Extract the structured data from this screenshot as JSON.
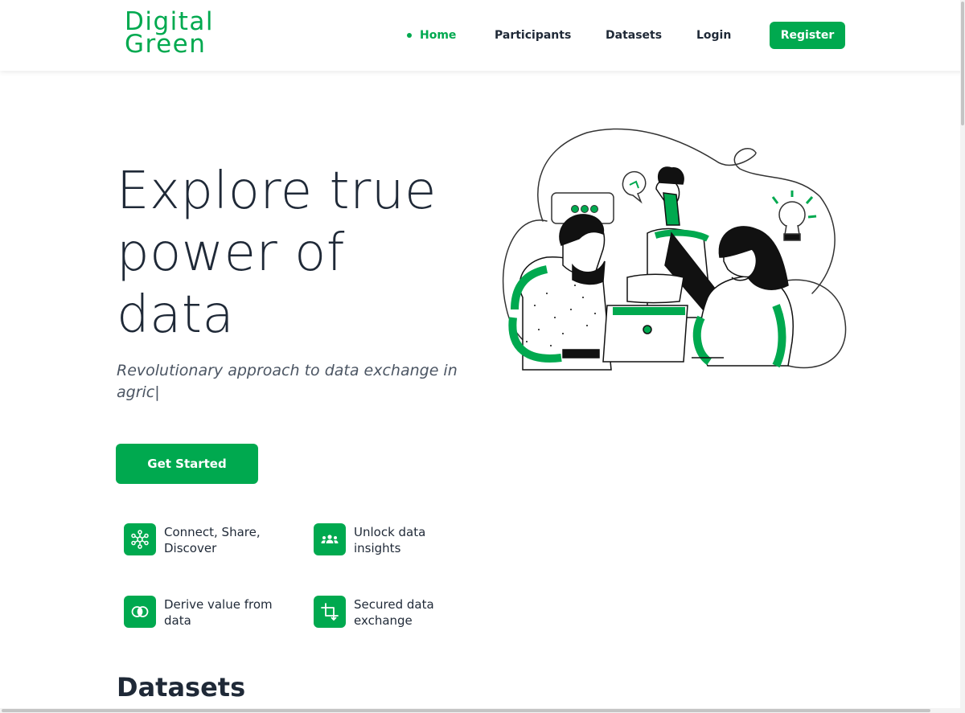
{
  "header": {
    "logo_line1": "Digital",
    "logo_line2": "Green",
    "nav": [
      {
        "label": "Home",
        "active": true
      },
      {
        "label": "Participants",
        "active": false
      },
      {
        "label": "Datasets",
        "active": false
      },
      {
        "label": "Login",
        "active": false
      }
    ],
    "register_label": "Register"
  },
  "hero": {
    "title": "Explore true power of data",
    "subtitle": "Revolutionary approach to data exchange in agric|",
    "cta_label": "Get Started",
    "illustration_icon": "team-collaboration-illustration"
  },
  "features": [
    {
      "label": "Connect, Share, Discover",
      "icon": "network-icon"
    },
    {
      "label": "Unlock data insights",
      "icon": "group-icon"
    },
    {
      "label": "Derive value from data",
      "icon": "overlapping-circles-icon"
    },
    {
      "label": "Secured data exchange",
      "icon": "crop-icon"
    }
  ],
  "datasets_section": {
    "title": "Datasets"
  },
  "colors": {
    "accent": "#00a94f",
    "text": "#1f2937",
    "muted": "#4b5563"
  }
}
